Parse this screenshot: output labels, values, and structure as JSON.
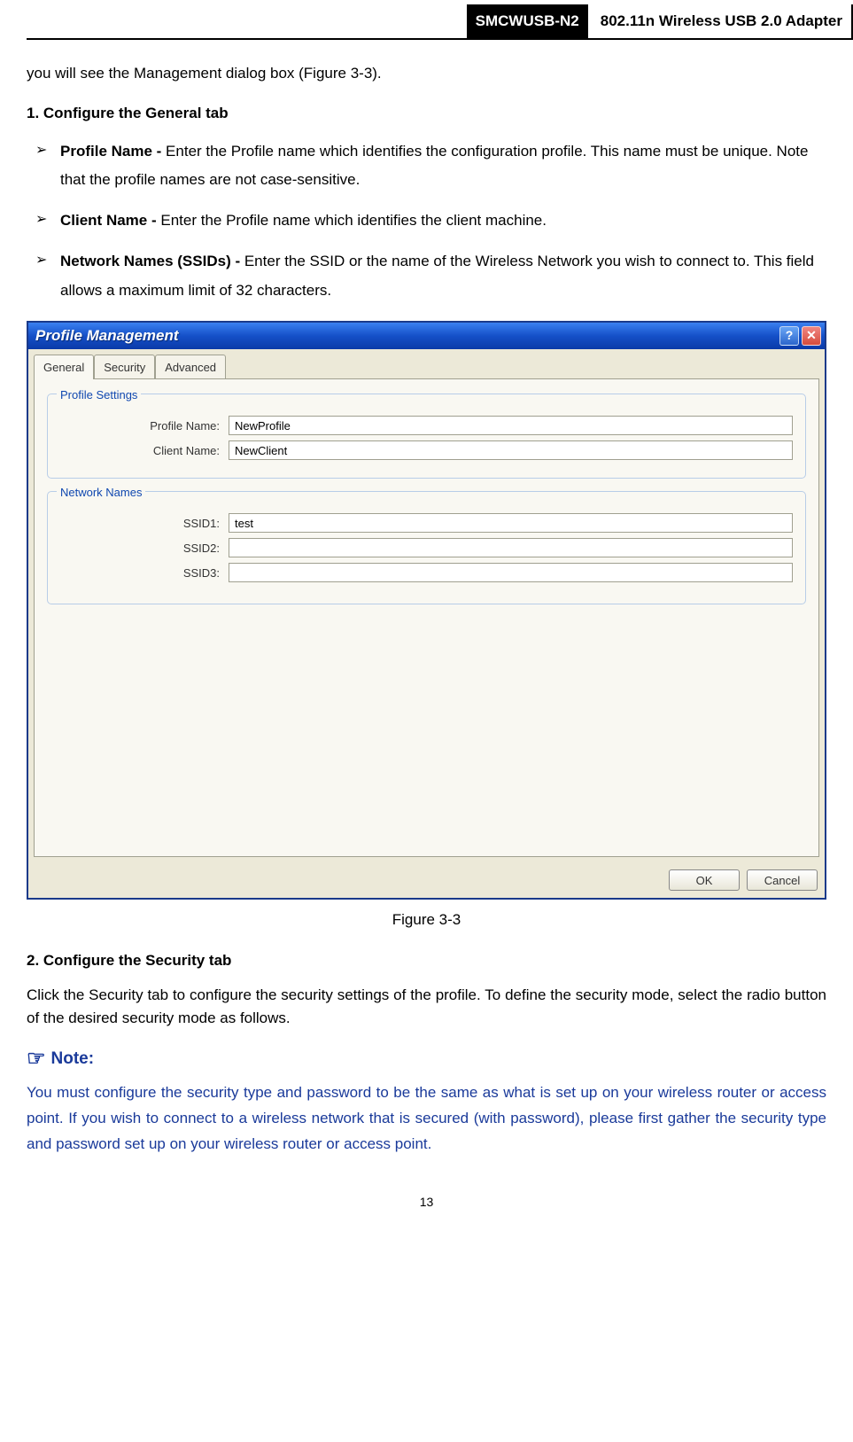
{
  "header": {
    "model": "SMCWUSB-N2",
    "desc": "802.11n Wireless USB 2.0 Adapter"
  },
  "intro": "you will see the Management dialog box (Figure 3-3).",
  "step1": {
    "title": "1.   Configure the General tab",
    "items": [
      {
        "bold": "Profile Name - ",
        "text": "Enter the Profile name which identifies the configuration profile. This name must be unique. Note that the profile names are not case-sensitive."
      },
      {
        "bold": "Client Name - ",
        "text": "Enter the Profile name which identifies the client machine."
      },
      {
        "bold": "Network Names (SSIDs) - ",
        "text": "Enter the SSID or the name of the Wireless Network you wish to connect to. This field allows a maximum limit of 32 characters."
      }
    ]
  },
  "dialog": {
    "title": "Profile Management",
    "tabs": [
      "General",
      "Security",
      "Advanced"
    ],
    "active_tab": 0,
    "group_profile": {
      "legend": "Profile Settings",
      "profile_name_label": "Profile Name:",
      "profile_name_value": "NewProfile",
      "client_name_label": "Client Name:",
      "client_name_value": "NewClient"
    },
    "group_network": {
      "legend": "Network Names",
      "ssid1_label": "SSID1:",
      "ssid1_value": "test",
      "ssid2_label": "SSID2:",
      "ssid2_value": "",
      "ssid3_label": "SSID3:",
      "ssid3_value": ""
    },
    "ok_label": "OK",
    "cancel_label": "Cancel"
  },
  "figure_caption": "Figure 3-3",
  "step2": {
    "title": "2.   Configure the Security tab",
    "body": "Click the Security tab to configure the security settings of the profile. To define the security mode, select the radio button of the desired security mode as follows."
  },
  "note": {
    "label": "Note:",
    "body": "You must configure the security type and password to be the same as what is set up on your wireless router or access point. If you wish to connect to a wireless network that is secured (with password), please first gather the security type and password set up on your wireless router or access point."
  },
  "page_number": "13"
}
